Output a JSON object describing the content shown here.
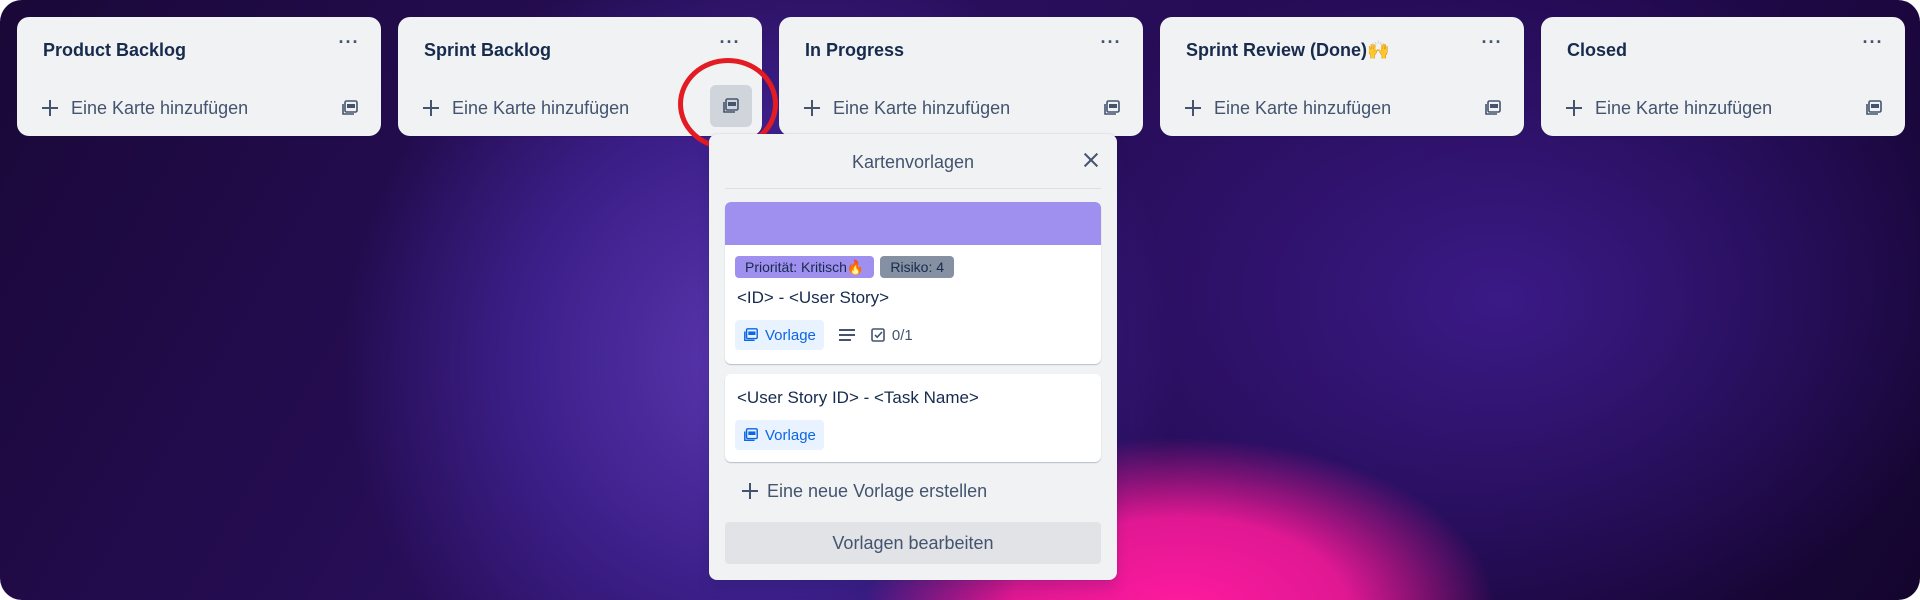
{
  "lists": [
    {
      "title": "Product Backlog",
      "add_label": "Eine Karte hinzufügen",
      "menu": "···"
    },
    {
      "title": "Sprint Backlog",
      "add_label": "Eine Karte hinzufügen",
      "menu": "···"
    },
    {
      "title": "In Progress",
      "add_label": "Eine Karte hinzufügen",
      "menu": "···"
    },
    {
      "title": "Sprint Review (Done)🙌",
      "add_label": "Eine Karte hinzufügen",
      "menu": "···"
    },
    {
      "title": "Closed",
      "add_label": "Eine Karte hinzufügen",
      "menu": "···"
    }
  ],
  "popover": {
    "title": "Kartenvorlagen",
    "templates": [
      {
        "cover_color": "#9f8fef",
        "labels": [
          {
            "text": "Priorität: Kritisch🔥",
            "color": "#9f8fef"
          },
          {
            "text": "Risiko: 4",
            "color": "#8590a2"
          }
        ],
        "title": "<ID> - <User Story>",
        "badge": "Vorlage",
        "has_description": true,
        "checklist": "0/1"
      },
      {
        "title": "<User Story ID> - <Task Name>",
        "badge": "Vorlage"
      }
    ],
    "create_label": "Eine neue Vorlage erstellen",
    "edit_button": "Vorlagen bearbeiten"
  },
  "colors": {
    "list_bg": "#f1f2f4",
    "highlight_ring": "#e31b23",
    "template_badge": "#0c66e4"
  }
}
